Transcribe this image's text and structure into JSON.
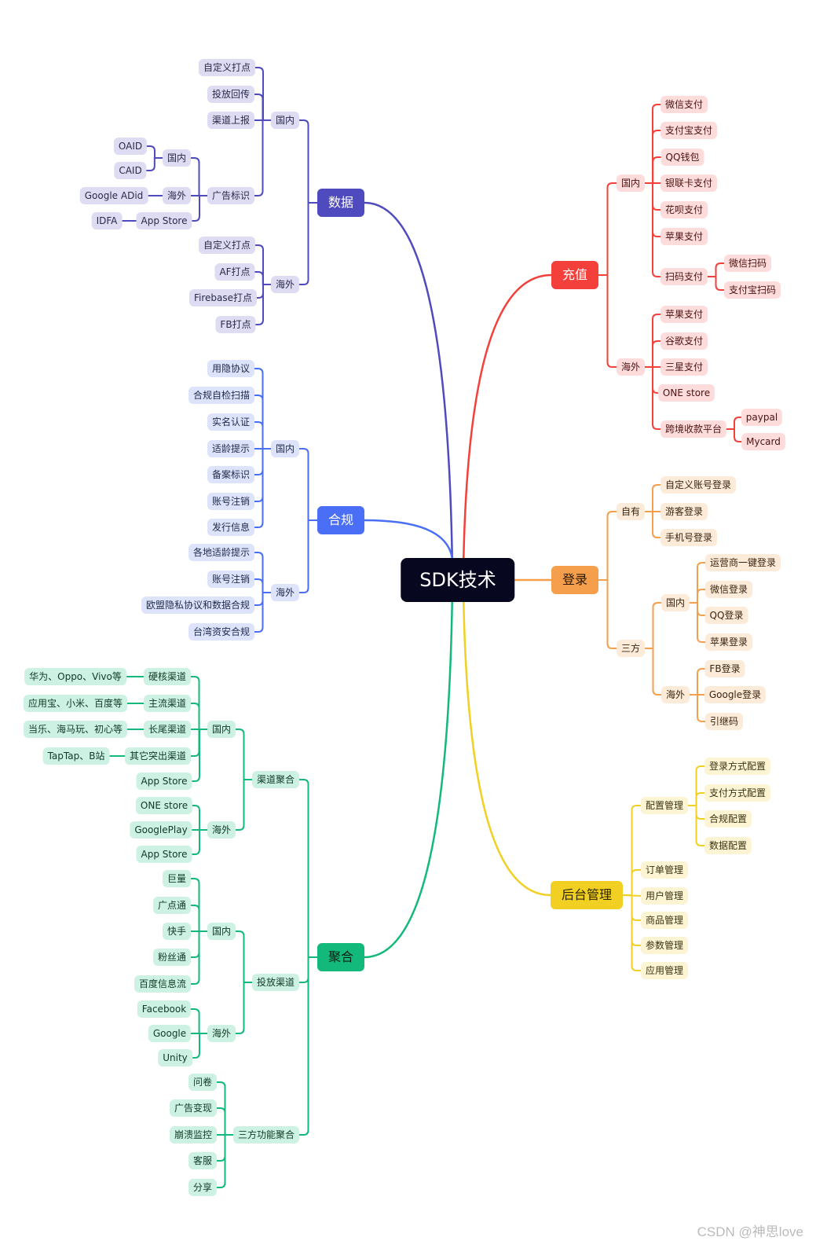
{
  "root": "SDK技术",
  "colors": {
    "data": {
      "line": "#4f4bbf",
      "main": "#4f4bbf",
      "mainText": "#ffffff",
      "leaf": "#dedcf3",
      "leafText": "#2a2a4a"
    },
    "compliance": {
      "line": "#4a6ef5",
      "main": "#4a6ef5",
      "mainText": "#ffffff",
      "leaf": "#dce3fb",
      "leafText": "#1f2a4a"
    },
    "aggregate": {
      "line": "#13b97a",
      "main": "#13b97a",
      "mainText": "#0b1e14",
      "leaf": "#cdf1e2",
      "leafText": "#0f3a28"
    },
    "recharge": {
      "line": "#f4403a",
      "main": "#f4403a",
      "mainText": "#ffffff",
      "leaf": "#fddcdb",
      "leafText": "#4a1210"
    },
    "login": {
      "line": "#f59e4b",
      "main": "#f59e4b",
      "mainText": "#2a1800",
      "leaf": "#fdebd9",
      "leafText": "#3a2410"
    },
    "backend": {
      "line": "#f1d023",
      "main": "#f1d023",
      "mainText": "#2a2400",
      "leaf": "#fcf4d2",
      "leafText": "#3a3210"
    }
  },
  "branches": [
    {
      "key": "data",
      "label": "数据",
      "children": [
        {
          "label": "国内",
          "children": [
            {
              "label": "自定义打点"
            },
            {
              "label": "投放回传"
            },
            {
              "label": "渠道上报"
            },
            {
              "label": "广告标识",
              "children": [
                {
                  "label": "国内",
                  "children": [
                    {
                      "label": "OAID"
                    },
                    {
                      "label": "CAID"
                    }
                  ]
                },
                {
                  "label": "海外",
                  "children": [
                    {
                      "label": "Google ADid"
                    }
                  ]
                },
                {
                  "label": "App Store",
                  "children": [
                    {
                      "label": "IDFA"
                    }
                  ]
                }
              ]
            }
          ]
        },
        {
          "label": "海外",
          "children": [
            {
              "label": "自定义打点"
            },
            {
              "label": "AF打点"
            },
            {
              "label": "Firebase打点"
            },
            {
              "label": "FB打点"
            }
          ]
        }
      ]
    },
    {
      "key": "compliance",
      "label": "合规",
      "children": [
        {
          "label": "国内",
          "children": [
            {
              "label": "用隐协议"
            },
            {
              "label": "合规自检扫描"
            },
            {
              "label": "实名认证"
            },
            {
              "label": "适龄提示"
            },
            {
              "label": "备案标识"
            },
            {
              "label": "账号注销"
            },
            {
              "label": "发行信息"
            }
          ]
        },
        {
          "label": "海外",
          "children": [
            {
              "label": "各地适龄提示"
            },
            {
              "label": "账号注销"
            },
            {
              "label": "欧盟隐私协议和数据合规"
            },
            {
              "label": "台湾资安合规"
            }
          ]
        }
      ]
    },
    {
      "key": "aggregate",
      "label": "聚合",
      "children": [
        {
          "label": "渠道聚合",
          "children": [
            {
              "label": "国内",
              "children": [
                {
                  "label": "硬核渠道",
                  "children": [
                    {
                      "label": "华为、Oppo、Vivo等"
                    }
                  ]
                },
                {
                  "label": "主流渠道",
                  "children": [
                    {
                      "label": "应用宝、小米、百度等"
                    }
                  ]
                },
                {
                  "label": "长尾渠道",
                  "children": [
                    {
                      "label": "当乐、海马玩、初心等"
                    }
                  ]
                },
                {
                  "label": "其它突出渠道",
                  "children": [
                    {
                      "label": "TapTap、B站"
                    }
                  ]
                },
                {
                  "label": "App Store"
                }
              ]
            },
            {
              "label": "海外",
              "children": [
                {
                  "label": "ONE store"
                },
                {
                  "label": "GooglePlay"
                },
                {
                  "label": "App Store"
                }
              ]
            }
          ]
        },
        {
          "label": "投放渠道",
          "children": [
            {
              "label": "国内",
              "children": [
                {
                  "label": "巨量"
                },
                {
                  "label": "广点通"
                },
                {
                  "label": "快手"
                },
                {
                  "label": "粉丝通"
                },
                {
                  "label": "百度信息流"
                }
              ]
            },
            {
              "label": "海外",
              "children": [
                {
                  "label": "Facebook"
                },
                {
                  "label": "Google"
                },
                {
                  "label": "Unity"
                }
              ]
            }
          ]
        },
        {
          "label": "三方功能聚合",
          "children": [
            {
              "label": "问卷"
            },
            {
              "label": "广告变现"
            },
            {
              "label": "崩溃监控"
            },
            {
              "label": "客服"
            },
            {
              "label": "分享"
            }
          ]
        }
      ]
    },
    {
      "key": "recharge",
      "label": "充值",
      "children": [
        {
          "label": "国内",
          "children": [
            {
              "label": "微信支付"
            },
            {
              "label": "支付宝支付"
            },
            {
              "label": "QQ钱包"
            },
            {
              "label": "银联卡支付"
            },
            {
              "label": "花呗支付"
            },
            {
              "label": "苹果支付"
            },
            {
              "label": "扫码支付",
              "children": [
                {
                  "label": "微信扫码"
                },
                {
                  "label": "支付宝扫码"
                }
              ]
            }
          ]
        },
        {
          "label": "海外",
          "children": [
            {
              "label": "苹果支付"
            },
            {
              "label": "谷歌支付"
            },
            {
              "label": "三星支付"
            },
            {
              "label": "ONE store"
            },
            {
              "label": "跨境收款平台",
              "children": [
                {
                  "label": "paypal"
                },
                {
                  "label": "Mycard"
                }
              ]
            }
          ]
        }
      ]
    },
    {
      "key": "login",
      "label": "登录",
      "children": [
        {
          "label": "自有",
          "children": [
            {
              "label": "自定义账号登录"
            },
            {
              "label": "游客登录"
            },
            {
              "label": "手机号登录"
            }
          ]
        },
        {
          "label": "三方",
          "children": [
            {
              "label": "国内",
              "children": [
                {
                  "label": "运营商一键登录"
                },
                {
                  "label": "微信登录"
                },
                {
                  "label": "QQ登录"
                },
                {
                  "label": "苹果登录"
                }
              ]
            },
            {
              "label": "海外",
              "children": [
                {
                  "label": "FB登录"
                },
                {
                  "label": "Google登录"
                },
                {
                  "label": "引继码"
                }
              ]
            }
          ]
        }
      ]
    },
    {
      "key": "backend",
      "label": "后台管理",
      "children": [
        {
          "label": "配置管理",
          "children": [
            {
              "label": "登录方式配置"
            },
            {
              "label": "支付方式配置"
            },
            {
              "label": "合规配置"
            },
            {
              "label": "数据配置"
            }
          ]
        },
        {
          "label": "订单管理"
        },
        {
          "label": "用户管理"
        },
        {
          "label": "商品管理"
        },
        {
          "label": "参数管理"
        },
        {
          "label": "应用管理"
        }
      ]
    }
  ],
  "watermark": "CSDN @神思love"
}
